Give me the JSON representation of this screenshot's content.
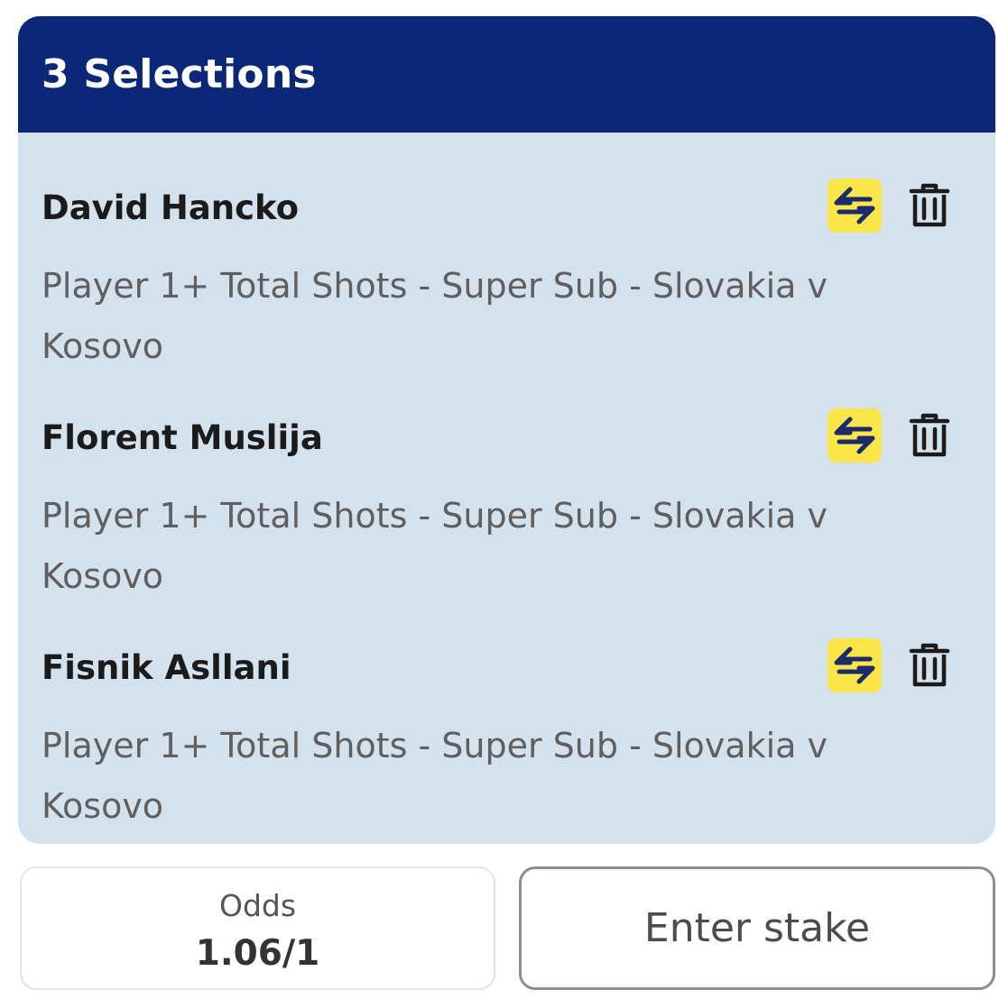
{
  "betslip": {
    "title": "3 Selections",
    "colors": {
      "header_bg": "#0c2778",
      "body_bg": "#d4e2ed",
      "swap_button_bg": "#fbe64a",
      "icon_dark": "#1a2a6c"
    },
    "selections": [
      {
        "name": "David Hancko",
        "market": "Player 1+ Total Shots - Super Sub - Slovakia v Kosovo",
        "swap_icon": "swap-arrows-icon",
        "delete_icon": "trash-icon"
      },
      {
        "name": "Florent Muslija",
        "market": "Player 1+ Total Shots - Super Sub - Slovakia v Kosovo",
        "swap_icon": "swap-arrows-icon",
        "delete_icon": "trash-icon"
      },
      {
        "name": "Fisnik Asllani",
        "market": "Player 1+ Total Shots - Super Sub - Slovakia v Kosovo",
        "swap_icon": "swap-arrows-icon",
        "delete_icon": "trash-icon"
      }
    ]
  },
  "footer": {
    "odds_label": "Odds",
    "odds_value": "1.06/1",
    "stake_placeholder": "Enter stake"
  }
}
